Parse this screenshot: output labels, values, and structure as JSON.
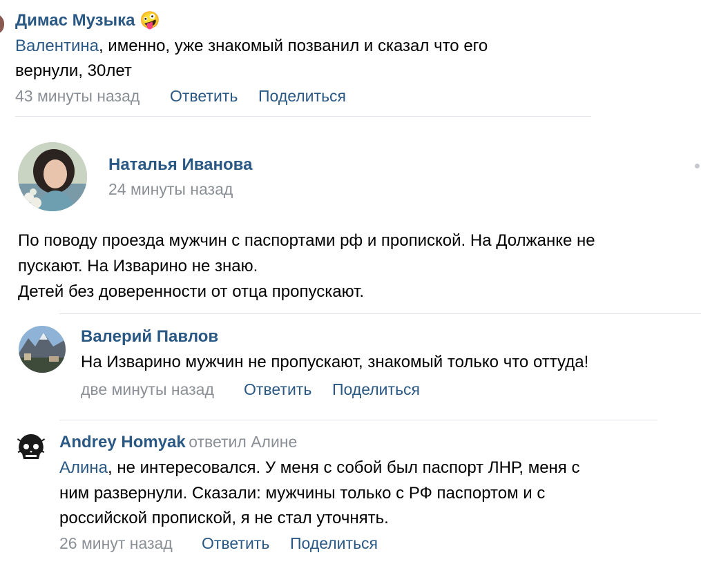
{
  "comments": [
    {
      "author": "Димас Музыка",
      "emoji": "🤪",
      "mention": "Валентина",
      "text_line1": ", именно, уже знакомый позванил и сказал что его",
      "text_line2": "вернули, 30лет",
      "time": "43 минуты назад",
      "reply": "Ответить",
      "share": "Поделиться"
    },
    {
      "author": "Наталья Иванова",
      "time": "24 минуты назад",
      "text_line1": "По поводу проезда мужчин с паспортами рф и пропиской. На Должанке не",
      "text_line2": "пускают. На Изварино не знаю.",
      "text_line3": "Детей без доверенности от отца пропускают."
    },
    {
      "author": "Валерий Павлов",
      "text_line1": "На Изварино мужчин не пропускают, знакомый только что оттуда!",
      "time": "две минуты назад",
      "reply": "Ответить",
      "share": "Поделиться"
    },
    {
      "author": "Andrey Homyak",
      "replied_to": "ответил Алине",
      "mention": "Алина",
      "text_line1": ", не интересовался. У меня с собой был паспорт ЛНР, меня с",
      "text_line2": "ним развернули. Сказали: мужчины только с РФ паспортом и с",
      "text_line3": "российской пропиской, я не стал уточнять.",
      "time": "26 минут назад",
      "reply": "Ответить",
      "share": "Поделиться"
    }
  ],
  "colors": {
    "link": "#2a5885",
    "meta": "#8a8f96",
    "divider": "#dfe2e6"
  }
}
